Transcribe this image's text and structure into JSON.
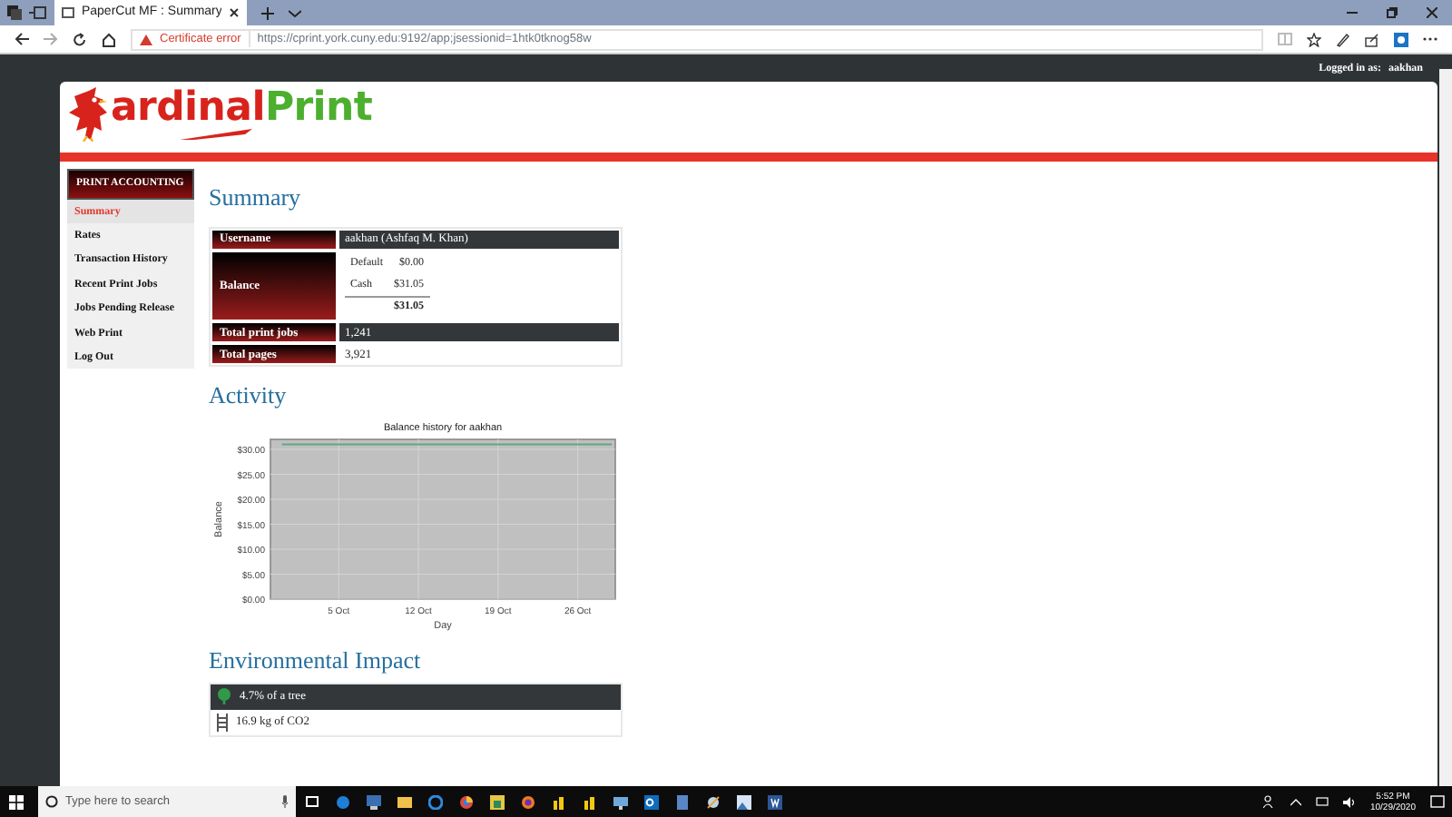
{
  "browser": {
    "tab_title": "PaperCut MF : Summary",
    "certificate_warning": "Certificate error",
    "url": "https://cprint.york.cuny.edu:9192/app;jsessionid=1htk0tknog58w"
  },
  "header": {
    "logged_in_label": "Logged in as:",
    "username": "aakhan",
    "logo_text_red": "ardinal",
    "logo_text_green": "Print"
  },
  "sidebar": {
    "title": "PRINT ACCOUNTING",
    "items": [
      {
        "label": "Summary",
        "selected": true
      },
      {
        "label": "Rates",
        "selected": false
      },
      {
        "label": "Transaction History",
        "selected": false
      },
      {
        "label": "Recent Print Jobs",
        "selected": false
      },
      {
        "label": "Jobs Pending Release",
        "selected": false
      },
      {
        "label": "Web Print",
        "selected": false
      },
      {
        "label": "Log Out",
        "selected": false
      }
    ]
  },
  "summary": {
    "title": "Summary",
    "rows": [
      {
        "kind": "text",
        "label": "Username",
        "value": "aakhan (Ashfaq M. Khan)",
        "highlighted": true
      },
      {
        "kind": "balance",
        "label": "Balance",
        "accounts": [
          {
            "name": "Default",
            "amount": "$0.00"
          },
          {
            "name": "Cash",
            "amount": "$31.05"
          }
        ],
        "total": "$31.05",
        "highlighted": false
      },
      {
        "kind": "text",
        "label": "Total print jobs",
        "value": "1,241",
        "highlighted": true
      },
      {
        "kind": "text",
        "label": "Total pages",
        "value": "3,921",
        "highlighted": false
      }
    ]
  },
  "activity": {
    "title": "Activity",
    "chart_data": {
      "type": "line",
      "title": "Balance history for aakhan",
      "xlabel": "Day",
      "ylabel": "Balance",
      "categories": [
        null,
        null,
        null,
        null,
        null,
        "5 Oct",
        null,
        null,
        null,
        null,
        null,
        null,
        "12 Oct",
        null,
        null,
        null,
        null,
        null,
        null,
        "19 Oct",
        null,
        null,
        null,
        null,
        null,
        null,
        "26 Oct",
        null,
        null,
        null
      ],
      "series": [
        {
          "color": "#5fa882",
          "values": [
            31,
            31,
            31,
            31,
            31,
            31,
            31,
            31,
            31,
            31,
            31,
            31,
            31,
            31,
            31,
            31,
            31,
            31,
            31,
            31,
            31,
            31,
            31,
            31,
            31,
            31,
            31,
            31,
            31,
            31
          ]
        }
      ],
      "ylim": [
        0,
        32
      ],
      "grid": true,
      "yticks": [
        {
          "value": 0,
          "label": "$0.00"
        },
        {
          "value": 5,
          "label": "$5.00"
        },
        {
          "value": 10,
          "label": "$10.00"
        },
        {
          "value": 15,
          "label": "$15.00"
        },
        {
          "value": 20,
          "label": "$20.00"
        },
        {
          "value": 25,
          "label": "$25.00"
        },
        {
          "value": 30,
          "label": "$30.00"
        }
      ]
    }
  },
  "environmental": {
    "title": "Environmental Impact",
    "items": [
      {
        "kind": "tree",
        "text": "4.7% of a tree"
      },
      {
        "kind": "co2",
        "text": "16.9 kg of CO2"
      }
    ]
  },
  "taskbar": {
    "search_placeholder": "Type here to search",
    "time": "5:52 PM",
    "date": "10/29/2020"
  }
}
